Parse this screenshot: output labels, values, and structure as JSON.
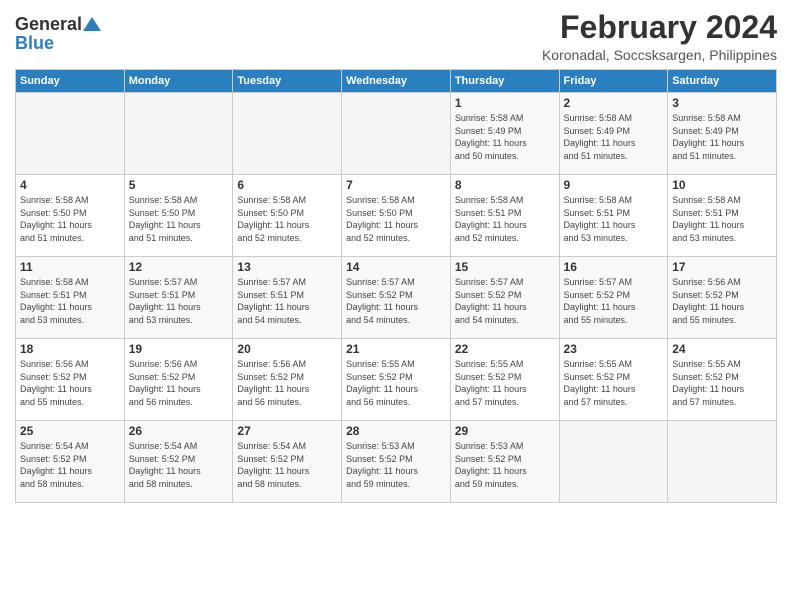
{
  "logo": {
    "general": "General",
    "blue": "Blue"
  },
  "title": {
    "month_year": "February 2024",
    "location": "Koronadal, Soccsksargen, Philippines"
  },
  "days_of_week": [
    "Sunday",
    "Monday",
    "Tuesday",
    "Wednesday",
    "Thursday",
    "Friday",
    "Saturday"
  ],
  "weeks": [
    [
      {
        "day": "",
        "info": ""
      },
      {
        "day": "",
        "info": ""
      },
      {
        "day": "",
        "info": ""
      },
      {
        "day": "",
        "info": ""
      },
      {
        "day": "1",
        "info": "Sunrise: 5:58 AM\nSunset: 5:49 PM\nDaylight: 11 hours\nand 50 minutes."
      },
      {
        "day": "2",
        "info": "Sunrise: 5:58 AM\nSunset: 5:49 PM\nDaylight: 11 hours\nand 51 minutes."
      },
      {
        "day": "3",
        "info": "Sunrise: 5:58 AM\nSunset: 5:49 PM\nDaylight: 11 hours\nand 51 minutes."
      }
    ],
    [
      {
        "day": "4",
        "info": "Sunrise: 5:58 AM\nSunset: 5:50 PM\nDaylight: 11 hours\nand 51 minutes."
      },
      {
        "day": "5",
        "info": "Sunrise: 5:58 AM\nSunset: 5:50 PM\nDaylight: 11 hours\nand 51 minutes."
      },
      {
        "day": "6",
        "info": "Sunrise: 5:58 AM\nSunset: 5:50 PM\nDaylight: 11 hours\nand 52 minutes."
      },
      {
        "day": "7",
        "info": "Sunrise: 5:58 AM\nSunset: 5:50 PM\nDaylight: 11 hours\nand 52 minutes."
      },
      {
        "day": "8",
        "info": "Sunrise: 5:58 AM\nSunset: 5:51 PM\nDaylight: 11 hours\nand 52 minutes."
      },
      {
        "day": "9",
        "info": "Sunrise: 5:58 AM\nSunset: 5:51 PM\nDaylight: 11 hours\nand 53 minutes."
      },
      {
        "day": "10",
        "info": "Sunrise: 5:58 AM\nSunset: 5:51 PM\nDaylight: 11 hours\nand 53 minutes."
      }
    ],
    [
      {
        "day": "11",
        "info": "Sunrise: 5:58 AM\nSunset: 5:51 PM\nDaylight: 11 hours\nand 53 minutes."
      },
      {
        "day": "12",
        "info": "Sunrise: 5:57 AM\nSunset: 5:51 PM\nDaylight: 11 hours\nand 53 minutes."
      },
      {
        "day": "13",
        "info": "Sunrise: 5:57 AM\nSunset: 5:51 PM\nDaylight: 11 hours\nand 54 minutes."
      },
      {
        "day": "14",
        "info": "Sunrise: 5:57 AM\nSunset: 5:52 PM\nDaylight: 11 hours\nand 54 minutes."
      },
      {
        "day": "15",
        "info": "Sunrise: 5:57 AM\nSunset: 5:52 PM\nDaylight: 11 hours\nand 54 minutes."
      },
      {
        "day": "16",
        "info": "Sunrise: 5:57 AM\nSunset: 5:52 PM\nDaylight: 11 hours\nand 55 minutes."
      },
      {
        "day": "17",
        "info": "Sunrise: 5:56 AM\nSunset: 5:52 PM\nDaylight: 11 hours\nand 55 minutes."
      }
    ],
    [
      {
        "day": "18",
        "info": "Sunrise: 5:56 AM\nSunset: 5:52 PM\nDaylight: 11 hours\nand 55 minutes."
      },
      {
        "day": "19",
        "info": "Sunrise: 5:56 AM\nSunset: 5:52 PM\nDaylight: 11 hours\nand 56 minutes."
      },
      {
        "day": "20",
        "info": "Sunrise: 5:56 AM\nSunset: 5:52 PM\nDaylight: 11 hours\nand 56 minutes."
      },
      {
        "day": "21",
        "info": "Sunrise: 5:55 AM\nSunset: 5:52 PM\nDaylight: 11 hours\nand 56 minutes."
      },
      {
        "day": "22",
        "info": "Sunrise: 5:55 AM\nSunset: 5:52 PM\nDaylight: 11 hours\nand 57 minutes."
      },
      {
        "day": "23",
        "info": "Sunrise: 5:55 AM\nSunset: 5:52 PM\nDaylight: 11 hours\nand 57 minutes."
      },
      {
        "day": "24",
        "info": "Sunrise: 5:55 AM\nSunset: 5:52 PM\nDaylight: 11 hours\nand 57 minutes."
      }
    ],
    [
      {
        "day": "25",
        "info": "Sunrise: 5:54 AM\nSunset: 5:52 PM\nDaylight: 11 hours\nand 58 minutes."
      },
      {
        "day": "26",
        "info": "Sunrise: 5:54 AM\nSunset: 5:52 PM\nDaylight: 11 hours\nand 58 minutes."
      },
      {
        "day": "27",
        "info": "Sunrise: 5:54 AM\nSunset: 5:52 PM\nDaylight: 11 hours\nand 58 minutes."
      },
      {
        "day": "28",
        "info": "Sunrise: 5:53 AM\nSunset: 5:52 PM\nDaylight: 11 hours\nand 59 minutes."
      },
      {
        "day": "29",
        "info": "Sunrise: 5:53 AM\nSunset: 5:52 PM\nDaylight: 11 hours\nand 59 minutes."
      },
      {
        "day": "",
        "info": ""
      },
      {
        "day": "",
        "info": ""
      }
    ]
  ]
}
